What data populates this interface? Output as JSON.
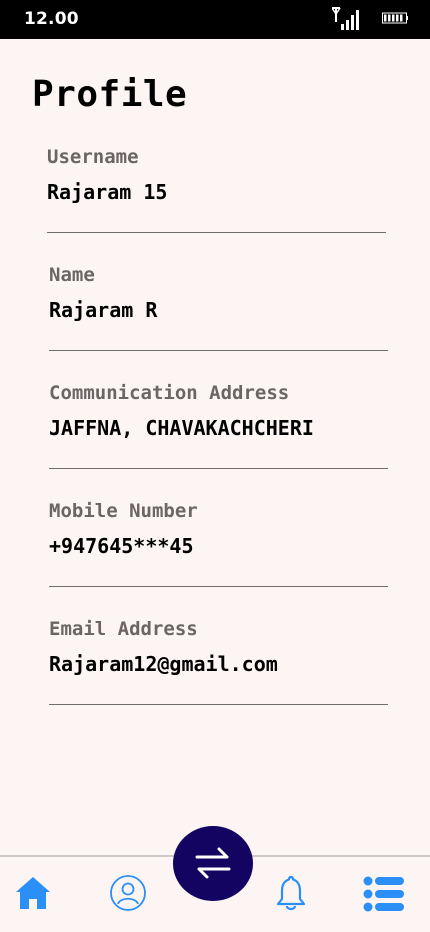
{
  "status_bar": {
    "time": "12.00",
    "signal_icon": "signal-icon",
    "battery_icon": "battery-icon"
  },
  "page": {
    "title": "Profile"
  },
  "fields": [
    {
      "label": "Username",
      "value": "Rajaram 15"
    },
    {
      "label": "Name",
      "value": "Rajaram R"
    },
    {
      "label": "Communication Address",
      "value": "JAFFNA, CHAVAKACHCHERI"
    },
    {
      "label": "Mobile Number",
      "value": "+947645***45"
    },
    {
      "label": "Email Address",
      "value": "Rajaram12@gmail.com"
    }
  ],
  "tab_bar": {
    "items": [
      {
        "icon": "home-icon",
        "color": "#2a8ff7"
      },
      {
        "icon": "user-icon",
        "color": "#2a8ff7"
      },
      {
        "icon": "swap-icon",
        "color": "#120460"
      },
      {
        "icon": "bell-icon",
        "color": "#2a8ff7"
      },
      {
        "icon": "list-icon",
        "color": "#2a8ff7"
      }
    ]
  }
}
